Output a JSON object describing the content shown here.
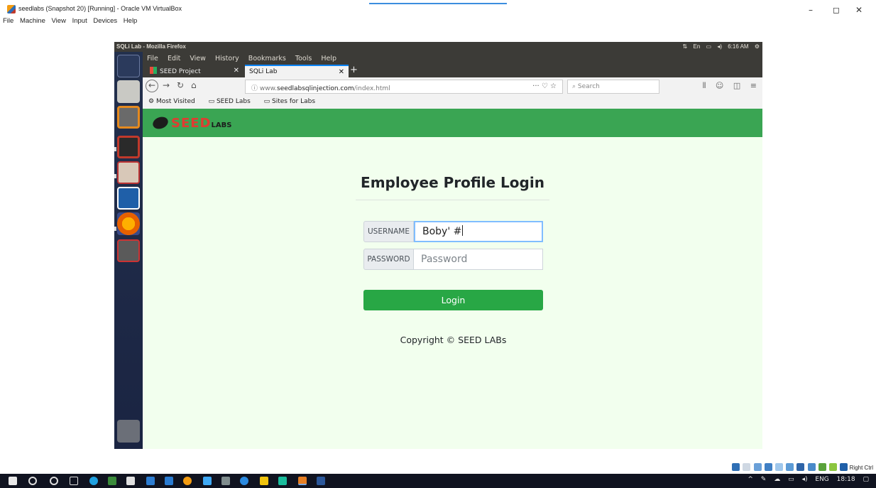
{
  "host_window": {
    "title": "seedlabs (Snapshot 20) [Running] - Oracle VM VirtualBox",
    "menu": [
      "File",
      "Machine",
      "View",
      "Input",
      "Devices",
      "Help"
    ],
    "controls": {
      "minimize": "–",
      "maximize": "◻",
      "close": "✕"
    }
  },
  "guest_panel": {
    "title": "SQLi Lab - Mozilla Firefox",
    "keyboard": "En",
    "time": "6:16 AM"
  },
  "firefox": {
    "menu": [
      "File",
      "Edit",
      "View",
      "History",
      "Bookmarks",
      "Tools",
      "Help"
    ],
    "tabs": [
      {
        "label": "SEED Project",
        "active": false
      },
      {
        "label": "SQLi Lab",
        "active": true
      }
    ],
    "new_tab": "+",
    "url_prefix": "www.",
    "url_domain": "seedlabsqlinjection.com",
    "url_path": "/index.html",
    "search_placeholder": "Search",
    "bookmarks": [
      "Most Visited",
      "SEED Labs",
      "Sites for Labs"
    ]
  },
  "page": {
    "logo_text": "SEED",
    "logo_suffix": "LABS",
    "heading": "Employee Profile Login",
    "username_label": "USERNAME",
    "username_value": "Boby' #",
    "password_label": "PASSWORD",
    "password_placeholder": "Password",
    "login_button": "Login",
    "copyright": "Copyright © SEED LABs"
  },
  "vbox_status": {
    "host_key": "Right Ctrl"
  },
  "taskbar": {
    "language": "ENG",
    "time": "18:18"
  },
  "colors": {
    "seed_green": "#3aa553",
    "login_green": "#28a745",
    "page_bg": "#f2ffee",
    "launcher": "#23304d"
  }
}
